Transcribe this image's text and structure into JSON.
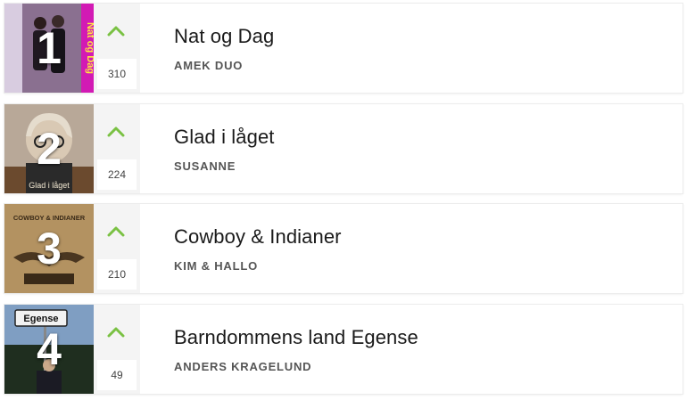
{
  "accent_color": "#7ac143",
  "vote_icon": "chevron-up-icon",
  "songs": [
    {
      "rank": "1",
      "title": "Nat og Dag",
      "artist": "AMEK DUO",
      "votes": "310",
      "cover_text": "Nat og Dag"
    },
    {
      "rank": "2",
      "title": "Glad i låget",
      "artist": "SUSANNE",
      "votes": "224",
      "cover_text": "Glad i låget"
    },
    {
      "rank": "3",
      "title": "Cowboy & Indianer",
      "artist": "KIM & HALLO",
      "votes": "210",
      "cover_text": "COWBOY & INDIANER"
    },
    {
      "rank": "4",
      "title": "Barndommens land Egense",
      "artist": "ANDERS KRAGELUND",
      "votes": "49",
      "cover_text": "Egense"
    }
  ]
}
